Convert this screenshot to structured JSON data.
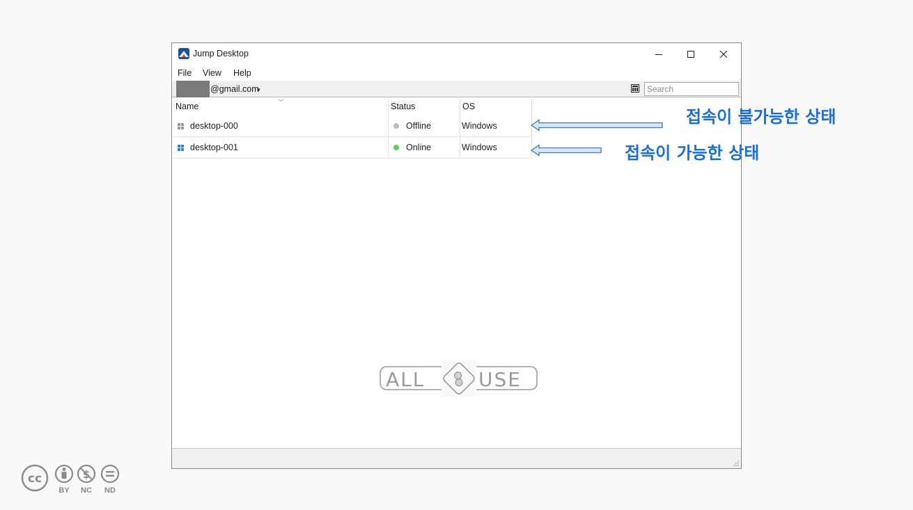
{
  "window": {
    "title": "Jump Desktop",
    "app_icon": "jump-desktop-logo-icon",
    "controls": [
      "minimize-icon",
      "maximize-icon",
      "close-icon"
    ]
  },
  "menu": {
    "file": "File",
    "view": "View",
    "help": "Help"
  },
  "account": {
    "email": "@gmail.com",
    "dropdown_icon": "chevron-down-icon"
  },
  "search": {
    "placeholder": "Search",
    "grid_icon": "grid-view-icon"
  },
  "table": {
    "columns": [
      "Name",
      "Status",
      "OS"
    ],
    "rows": [
      {
        "name": "desktop-000",
        "status": "Offline",
        "os": "Windows",
        "status_color": "#bdbdbd",
        "icon_color": "#9a9a9a"
      },
      {
        "name": "desktop-001",
        "status": "Online",
        "os": "Windows",
        "status_color": "#5ccf5c",
        "icon_color": "#2f7fd4"
      }
    ]
  },
  "annotations": {
    "offline_note": "접속이 불가능한 상태",
    "online_note": "접속이 가능한 상태",
    "color": "#1a6ed8"
  },
  "watermark": {
    "left": "ALL",
    "right": "USE"
  },
  "license": {
    "cc": "cc",
    "by": "BY",
    "nc": "NC",
    "nd": "ND"
  }
}
